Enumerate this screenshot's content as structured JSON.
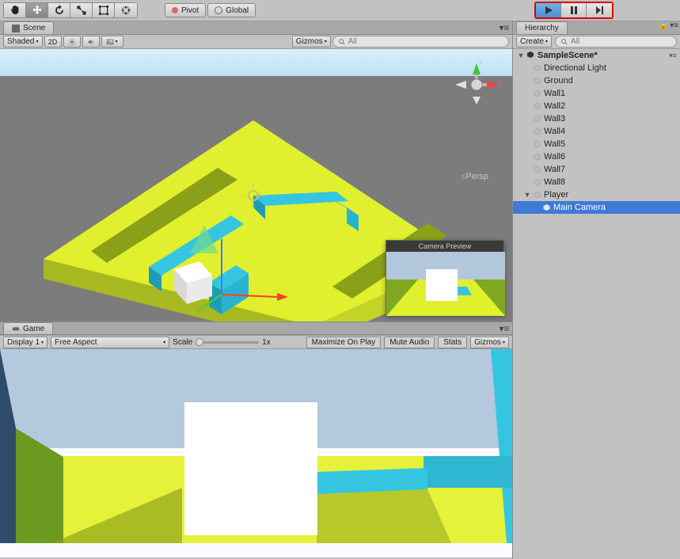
{
  "toolbar": {
    "pivot_label": "Pivot",
    "global_label": "Global"
  },
  "scene": {
    "tab_label": "Scene",
    "shading": "Shaded",
    "mode_2d": "2D",
    "gizmos": "Gizmos",
    "search_placeholder": "All",
    "persp": "Persp",
    "camera_preview_title": "Camera Preview"
  },
  "game": {
    "tab_label": "Game",
    "display": "Display 1",
    "aspect": "Free Aspect",
    "scale_label": "Scale",
    "scale_value": "1x",
    "maximize": "Maximize On Play",
    "mute": "Mute Audio",
    "stats": "Stats",
    "gizmos": "Gizmos"
  },
  "hierarchy": {
    "tab_label": "Hierarchy",
    "create": "Create",
    "search_placeholder": "All",
    "scene_name": "SampleScene*",
    "items": [
      {
        "label": "Directional Light"
      },
      {
        "label": "Ground"
      },
      {
        "label": "Wall1"
      },
      {
        "label": "Wall2"
      },
      {
        "label": "Wall3"
      },
      {
        "label": "Wall4"
      },
      {
        "label": "Wall5"
      },
      {
        "label": "Wall6"
      },
      {
        "label": "Wall7"
      },
      {
        "label": "Wall8"
      },
      {
        "label": "Player"
      },
      {
        "label": "Main Camera"
      }
    ]
  },
  "colors": {
    "highlight_red": "#d00",
    "selection_blue": "#3e7ad6"
  }
}
